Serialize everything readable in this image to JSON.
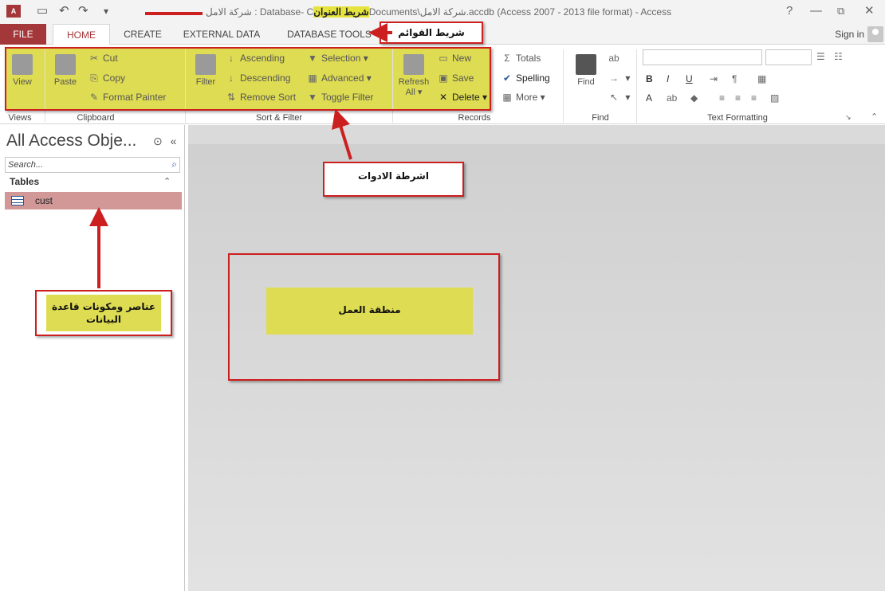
{
  "titlebar": {
    "app_icon": "A⃞",
    "undo": "↶",
    "redo": "↷",
    "customize": "⌅",
    "title_prefix": "شركة الامل : Database- C",
    "title_highlight": "شريط العنوان",
    "title_suffix": "Documents\\شركة الامل.accdb (Access 2007 - 2013 file format) - Access",
    "help": "?",
    "minimize": "—",
    "restore": "🗗",
    "close": "✕"
  },
  "tabs": [
    "FILE",
    "HOME",
    "CREATE",
    "EXTERNAL DATA",
    "DATABASE TOOLS"
  ],
  "signin": "Sign in",
  "ribbon": {
    "views": {
      "view": "View",
      "group": "Views"
    },
    "clipboard": {
      "paste": "Paste",
      "cut": "Cut",
      "copy": "Copy",
      "format_painter": "Format Painter",
      "group": "Clipboard"
    },
    "sort_filter": {
      "filter": "Filter",
      "ascending": "Ascending",
      "descending": "Descending",
      "remove_sort": "Remove Sort",
      "selection": "Selection",
      "advanced": "Advanced",
      "toggle_filter": "Toggle Filter",
      "group": "Sort & Filter"
    },
    "records": {
      "refresh": "Refresh",
      "refresh_all": "All",
      "new": "New",
      "save": "Save",
      "delete": "Delete",
      "totals": "Totals",
      "spelling": "Spelling",
      "more": "More",
      "group": "Records"
    },
    "find": {
      "find": "Find",
      "group": "Find"
    },
    "text_formatting": {
      "bold": "B",
      "italic": "I",
      "underline": "U",
      "font_color": "A",
      "group": "Text Formatting"
    }
  },
  "nav": {
    "title": "All Access Obje...",
    "collapse": "«",
    "menu": "⊙",
    "search_placeholder": "Search...",
    "section": "Tables",
    "section_toggle": "≈",
    "items": [
      {
        "label": "cust"
      }
    ]
  },
  "annotations": {
    "menu_bar": "شريط القوائم",
    "toolbars": "اشرطة الادوات",
    "db_components_line1": "عناصر ومكونات قاعدة",
    "db_components_line2": "البيانات",
    "work_area": "منطقة العمل"
  },
  "colors": {
    "accent": "#a4373a",
    "highlight": "#dedc52",
    "annotation": "#cc1f1f"
  }
}
